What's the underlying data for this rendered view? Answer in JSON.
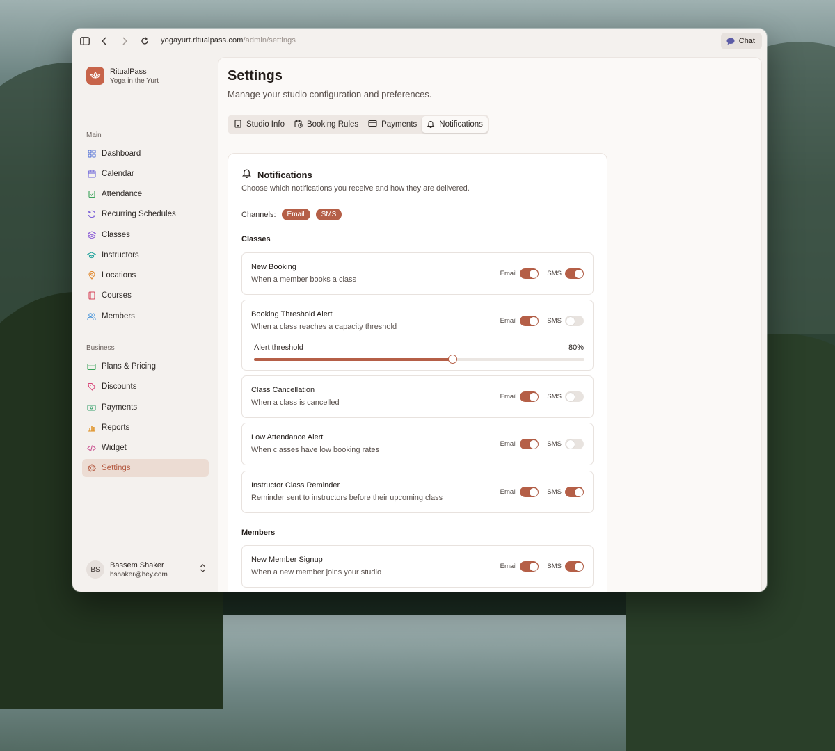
{
  "browser": {
    "url_host": "yogayurt.ritualpass.com",
    "url_path": "/admin/settings",
    "chat_label": "Chat"
  },
  "brand": {
    "name": "RitualPass",
    "subtitle": "Yoga in the Yurt",
    "color": "#c7644a"
  },
  "sidebar": {
    "main_label": "Main",
    "main_items": [
      {
        "label": "Dashboard",
        "icon": "grid-icon"
      },
      {
        "label": "Calendar",
        "icon": "calendar-icon"
      },
      {
        "label": "Attendance",
        "icon": "clipboard-check-icon"
      },
      {
        "label": "Recurring Schedules",
        "icon": "repeat-icon"
      },
      {
        "label": "Classes",
        "icon": "layers-icon"
      },
      {
        "label": "Instructors",
        "icon": "graduation-cap-icon"
      },
      {
        "label": "Locations",
        "icon": "map-pin-icon"
      },
      {
        "label": "Courses",
        "icon": "book-icon"
      },
      {
        "label": "Members",
        "icon": "users-icon"
      }
    ],
    "business_label": "Business",
    "business_items": [
      {
        "label": "Plans & Pricing",
        "icon": "credit-card-icon"
      },
      {
        "label": "Discounts",
        "icon": "tag-icon"
      },
      {
        "label": "Payments",
        "icon": "banknote-icon"
      },
      {
        "label": "Reports",
        "icon": "bar-chart-icon"
      },
      {
        "label": "Widget",
        "icon": "code-icon"
      },
      {
        "label": "Settings",
        "icon": "gear-icon",
        "active": true
      }
    ]
  },
  "user": {
    "initials": "BS",
    "name": "Bassem Shaker",
    "email": "bshaker@hey.com"
  },
  "page": {
    "title": "Settings",
    "subtitle": "Manage your studio configuration and preferences.",
    "tabs": [
      {
        "label": "Studio Info",
        "icon": "building-icon"
      },
      {
        "label": "Booking Rules",
        "icon": "calendar-clock-icon"
      },
      {
        "label": "Payments",
        "icon": "credit-card-icon"
      },
      {
        "label": "Notifications",
        "icon": "bell-icon",
        "active": true
      }
    ]
  },
  "notifications": {
    "title": "Notifications",
    "description": "Choose which notifications you receive and how they are delivered.",
    "channels_label": "Channels:",
    "channels": [
      "Email",
      "SMS"
    ],
    "email_label": "Email",
    "sms_label": "SMS",
    "classes_label": "Classes",
    "members_label": "Members",
    "classes_rows": [
      {
        "title": "New Booking",
        "desc": "When a member books a class",
        "email": true,
        "sms": true
      },
      {
        "title": "Booking Threshold Alert",
        "desc": "When a class reaches a capacity threshold",
        "email": true,
        "sms": false,
        "threshold_label": "Alert threshold",
        "threshold_value": "80%",
        "threshold_fraction": 0.6
      },
      {
        "title": "Class Cancellation",
        "desc": "When a class is cancelled",
        "email": true,
        "sms": false
      },
      {
        "title": "Low Attendance Alert",
        "desc": "When classes have low booking rates",
        "email": true,
        "sms": false
      },
      {
        "title": "Instructor Class Reminder",
        "desc": "Reminder sent to instructors before their upcoming class",
        "email": true,
        "sms": true
      }
    ],
    "members_rows": [
      {
        "title": "New Member Signup",
        "desc": "When a new member joins your studio",
        "email": true,
        "sms": true
      }
    ]
  },
  "colors": {
    "accent": "#b55f47",
    "active_nav_bg": "#ecdcd3"
  }
}
